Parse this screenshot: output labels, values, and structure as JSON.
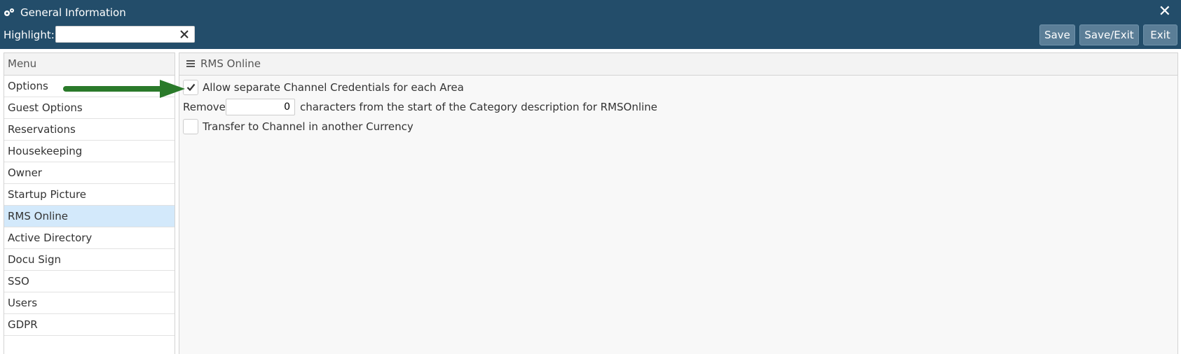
{
  "window": {
    "title": "General Information",
    "title_icon": "gears-icon",
    "close_glyph": "✕"
  },
  "toolbar": {
    "highlight_label": "Highlight:",
    "highlight_value": "",
    "save_label": "Save",
    "save_exit_label": "Save/Exit",
    "exit_label": "Exit"
  },
  "menu": {
    "header": "Menu",
    "items": [
      {
        "label": "Options"
      },
      {
        "label": "Guest Options"
      },
      {
        "label": "Reservations"
      },
      {
        "label": "Housekeeping"
      },
      {
        "label": "Owner"
      },
      {
        "label": "Startup Picture"
      },
      {
        "label": "RMS Online",
        "active": true
      },
      {
        "label": "Active Directory"
      },
      {
        "label": "Docu Sign"
      },
      {
        "label": "SSO"
      },
      {
        "label": "Users"
      },
      {
        "label": "GDPR"
      }
    ]
  },
  "panel": {
    "title": "RMS Online",
    "allow_credentials": {
      "label": "Allow separate Channel Credentials for each Area",
      "checked": true
    },
    "remove_chars": {
      "prefix": "Remove",
      "value": "0",
      "suffix": "characters from the start of the Category description for RMSOnline"
    },
    "transfer_currency": {
      "label": "Transfer to Channel in another Currency",
      "checked": false
    }
  },
  "colors": {
    "titlebar": "#234d6a",
    "button": "#5b7e97",
    "active_menu": "#d3e9fb",
    "annotation_arrow": "#2a7a2a"
  }
}
